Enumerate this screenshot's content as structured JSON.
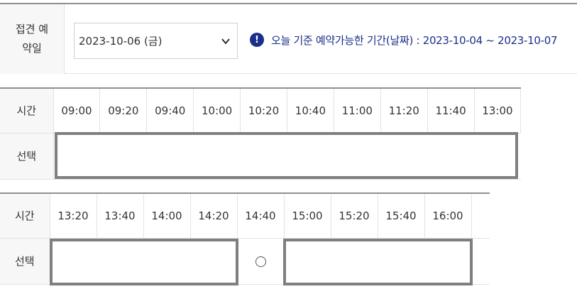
{
  "visit_date": {
    "label_line1": "접견 예",
    "label_line2": "약일",
    "selected_value": "2023-10-06 (금)",
    "notice_icon": "!",
    "notice_text": "오늘 기준 예약가능한 기간(날짜) : 2023-10-04 ~ 2023-10-07"
  },
  "table1": {
    "time_header": "시간",
    "select_header": "선택",
    "times": [
      "09:00",
      "09:20",
      "09:40",
      "10:00",
      "10:20",
      "10:40",
      "11:00",
      "11:20",
      "11:40",
      "13:00"
    ]
  },
  "table2": {
    "time_header": "시간",
    "select_header": "선택",
    "times": [
      "13:20",
      "13:40",
      "14:00",
      "14:20",
      "14:40",
      "15:00",
      "15:20",
      "15:40",
      "16:00"
    ],
    "available_slot": "14:40"
  },
  "colors": {
    "accent": "#1a2f8a",
    "box_border": "#7f7f7f",
    "header_bg": "#f7f7f7"
  }
}
